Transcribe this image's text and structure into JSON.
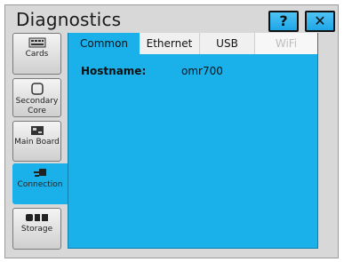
{
  "window": {
    "title": "Diagnostics"
  },
  "top_buttons": {
    "help": "?",
    "close": "✕"
  },
  "sidebar": {
    "items": [
      {
        "label": "Cards",
        "icon": "cards-icon"
      },
      {
        "label": "Secondary Core",
        "icon": "secondary-core-icon"
      },
      {
        "label": "Main Board",
        "icon": "main-board-icon"
      },
      {
        "label": "Connection",
        "icon": "connection-icon",
        "active": true
      },
      {
        "label": "Storage",
        "icon": "storage-icon"
      }
    ]
  },
  "tabs": [
    {
      "label": "Common",
      "active": true
    },
    {
      "label": "Ethernet"
    },
    {
      "label": "USB"
    },
    {
      "label": "WiFi",
      "disabled": true
    }
  ],
  "common": {
    "hostname_label": "Hostname:",
    "hostname_value": "omr700"
  },
  "colors": {
    "accent": "#1ab0ea",
    "background": "#d8d8d8"
  }
}
